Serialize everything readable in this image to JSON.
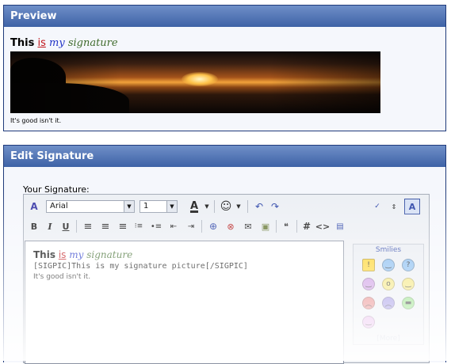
{
  "preview": {
    "header": "Preview",
    "sig_this": "This",
    "sig_is": "is",
    "sig_my": "my",
    "sig_signature": "signature",
    "caption": "It's good isn't it."
  },
  "edit": {
    "header": "Edit Signature",
    "label": "Your Signature:",
    "font_value": "Arial",
    "size_value": "1",
    "text_sig_this": "This",
    "text_sig_is": "is",
    "text_sig_my": "my",
    "text_sig_signature": "signature",
    "text_line1": "[SIGPIC]This is my signature picture[/SIGPIC]",
    "text_line2": "It's good isn't it.",
    "smilies_title": "Smilies",
    "smilies_more": "[More]"
  },
  "icons": {
    "remove_format": "remove-format-icon",
    "font_color": "font-color-icon",
    "smiley": "smiley-icon",
    "undo": "undo-icon",
    "redo": "redo-icon",
    "spellcheck": "spellcheck-icon",
    "resize": "resize-icon",
    "mode": "wysiwyg-mode-icon"
  },
  "colors": {
    "header_top": "#6f8fc8",
    "header_bottom": "#3e62a6",
    "accent_red": "#c0151b",
    "accent_blue": "#2234c8",
    "accent_green": "#3f6b2c"
  }
}
